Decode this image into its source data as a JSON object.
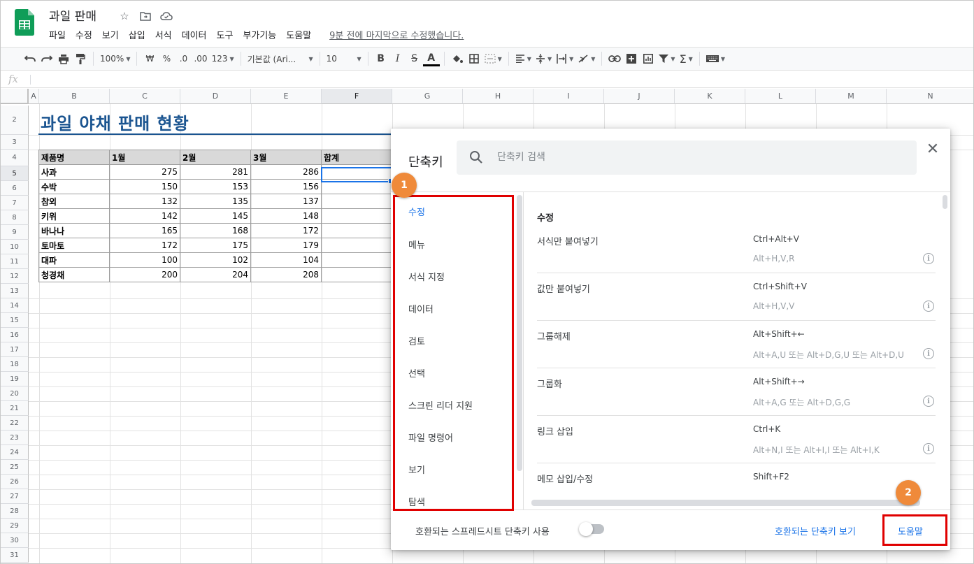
{
  "header": {
    "title": "과일 판매",
    "menu": [
      "파일",
      "수정",
      "보기",
      "삽입",
      "서식",
      "데이터",
      "도구",
      "부가기능",
      "도움말"
    ],
    "last_edit": "9분 전에 마지막으로 수정했습니다."
  },
  "toolbar": {
    "zoom": "100%",
    "currency": "₩",
    "percent": "%",
    "dec_decrease": ".0",
    "dec_increase": ".00",
    "format_more": "123",
    "font": "기본값 (Ari...",
    "font_size": "10",
    "bold": "B",
    "italic": "I",
    "strike": "S",
    "text_color": "A"
  },
  "formula_bar": {
    "fx": "fx"
  },
  "grid": {
    "columns": [
      "A",
      "B",
      "C",
      "D",
      "E",
      "F",
      "G",
      "H",
      "I",
      "J",
      "K",
      "L",
      "M",
      "N"
    ],
    "rows": [
      "2",
      "3",
      "4",
      "5",
      "6",
      "7",
      "8",
      "9",
      "10",
      "11",
      "12",
      "13",
      "14",
      "15",
      "16",
      "17",
      "18",
      "19",
      "20",
      "21",
      "22",
      "23",
      "24",
      "25",
      "26",
      "27",
      "28",
      "29",
      "30",
      "31"
    ]
  },
  "sheet": {
    "title": "과일 야채 판매 현황",
    "headers": [
      "제품명",
      "1월",
      "2월",
      "3월",
      "합계"
    ],
    "rows": [
      {
        "name": "사과",
        "m1": "275",
        "m2": "281",
        "m3": "286"
      },
      {
        "name": "수박",
        "m1": "150",
        "m2": "153",
        "m3": "156"
      },
      {
        "name": "참외",
        "m1": "132",
        "m2": "135",
        "m3": "137"
      },
      {
        "name": "키위",
        "m1": "142",
        "m2": "145",
        "m3": "148"
      },
      {
        "name": "바나나",
        "m1": "165",
        "m2": "168",
        "m3": "172"
      },
      {
        "name": "토마토",
        "m1": "172",
        "m2": "175",
        "m3": "179"
      },
      {
        "name": "대파",
        "m1": "100",
        "m2": "102",
        "m3": "104"
      },
      {
        "name": "청경채",
        "m1": "200",
        "m2": "204",
        "m3": "208"
      }
    ]
  },
  "dialog": {
    "title": "단축키",
    "search_placeholder": "단축키 검색",
    "categories": [
      "수정",
      "메뉴",
      "서식 지정",
      "데이터",
      "검토",
      "선택",
      "스크린 리더 지원",
      "파일 명령어",
      "보기",
      "탐색"
    ],
    "section": "수정",
    "shortcuts": [
      {
        "name": "서식만 붙여넣기",
        "key": "Ctrl+Alt+V",
        "alt": "Alt+H,V,R"
      },
      {
        "name": "값만 붙여넣기",
        "key": "Ctrl+Shift+V",
        "alt": "Alt+H,V,V"
      },
      {
        "name": "그룹해제",
        "key": "Alt+Shift+←",
        "alt": "Alt+A,U 또는 Alt+D,G,U 또는 Alt+D,U"
      },
      {
        "name": "그룹화",
        "key": "Alt+Shift+→",
        "alt": "Alt+A,G 또는 Alt+D,G,G"
      },
      {
        "name": "링크 삽입",
        "key": "Ctrl+K",
        "alt": "Alt+N,I 또는 Alt+I,I 또는 Alt+I,K"
      },
      {
        "name": "메모 삽입/수정",
        "key": "Shift+F2",
        "alt": ""
      }
    ],
    "compat_label": "호환되는 스프레드시트 단축키 사용",
    "compat_link": "호환되는 단축키 보기",
    "help": "도움말"
  },
  "annotations": {
    "badge1": "1",
    "badge2": "2"
  }
}
